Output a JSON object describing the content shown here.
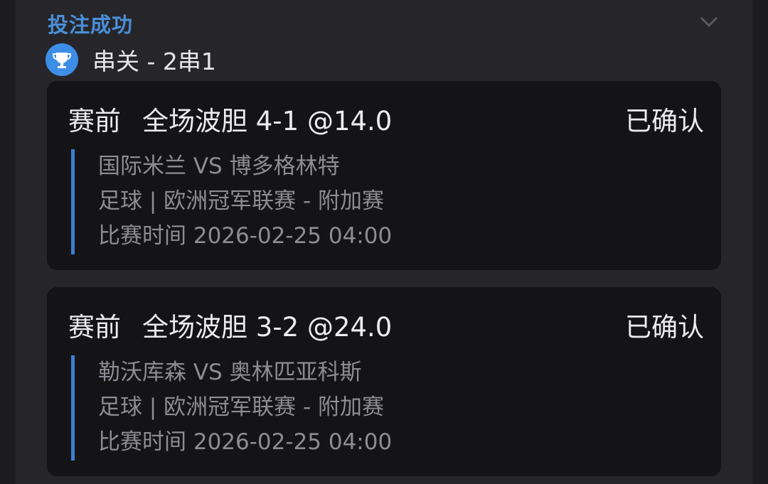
{
  "header": {
    "status_title": "投注成功",
    "bet_type": "串关 - 2串1"
  },
  "icons": {
    "bet_type_icon": "trophy-icon",
    "collapse_icon": "chevron-down-icon"
  },
  "colors": {
    "accent": "#4a8fd8",
    "trophy_bg": "#3d8ee6",
    "detail_bar": "#3a7fd0",
    "card_bg": "#141417",
    "panel_bg": "#26262a"
  },
  "selections": [
    {
      "phase": "赛前",
      "market": "全场波胆 4-1 @14.0",
      "status": "已确认",
      "match": "国际米兰 VS 博多格林特",
      "competition": "足球 | 欧洲冠军联赛 - 附加赛",
      "time": "比赛时间 2026-02-25 04:00"
    },
    {
      "phase": "赛前",
      "market": "全场波胆 3-2 @24.0",
      "status": "已确认",
      "match": "勒沃库森 VS 奥林匹亚科斯",
      "competition": "足球 | 欧洲冠军联赛 - 附加赛",
      "time": "比赛时间 2026-02-25 04:00"
    }
  ]
}
